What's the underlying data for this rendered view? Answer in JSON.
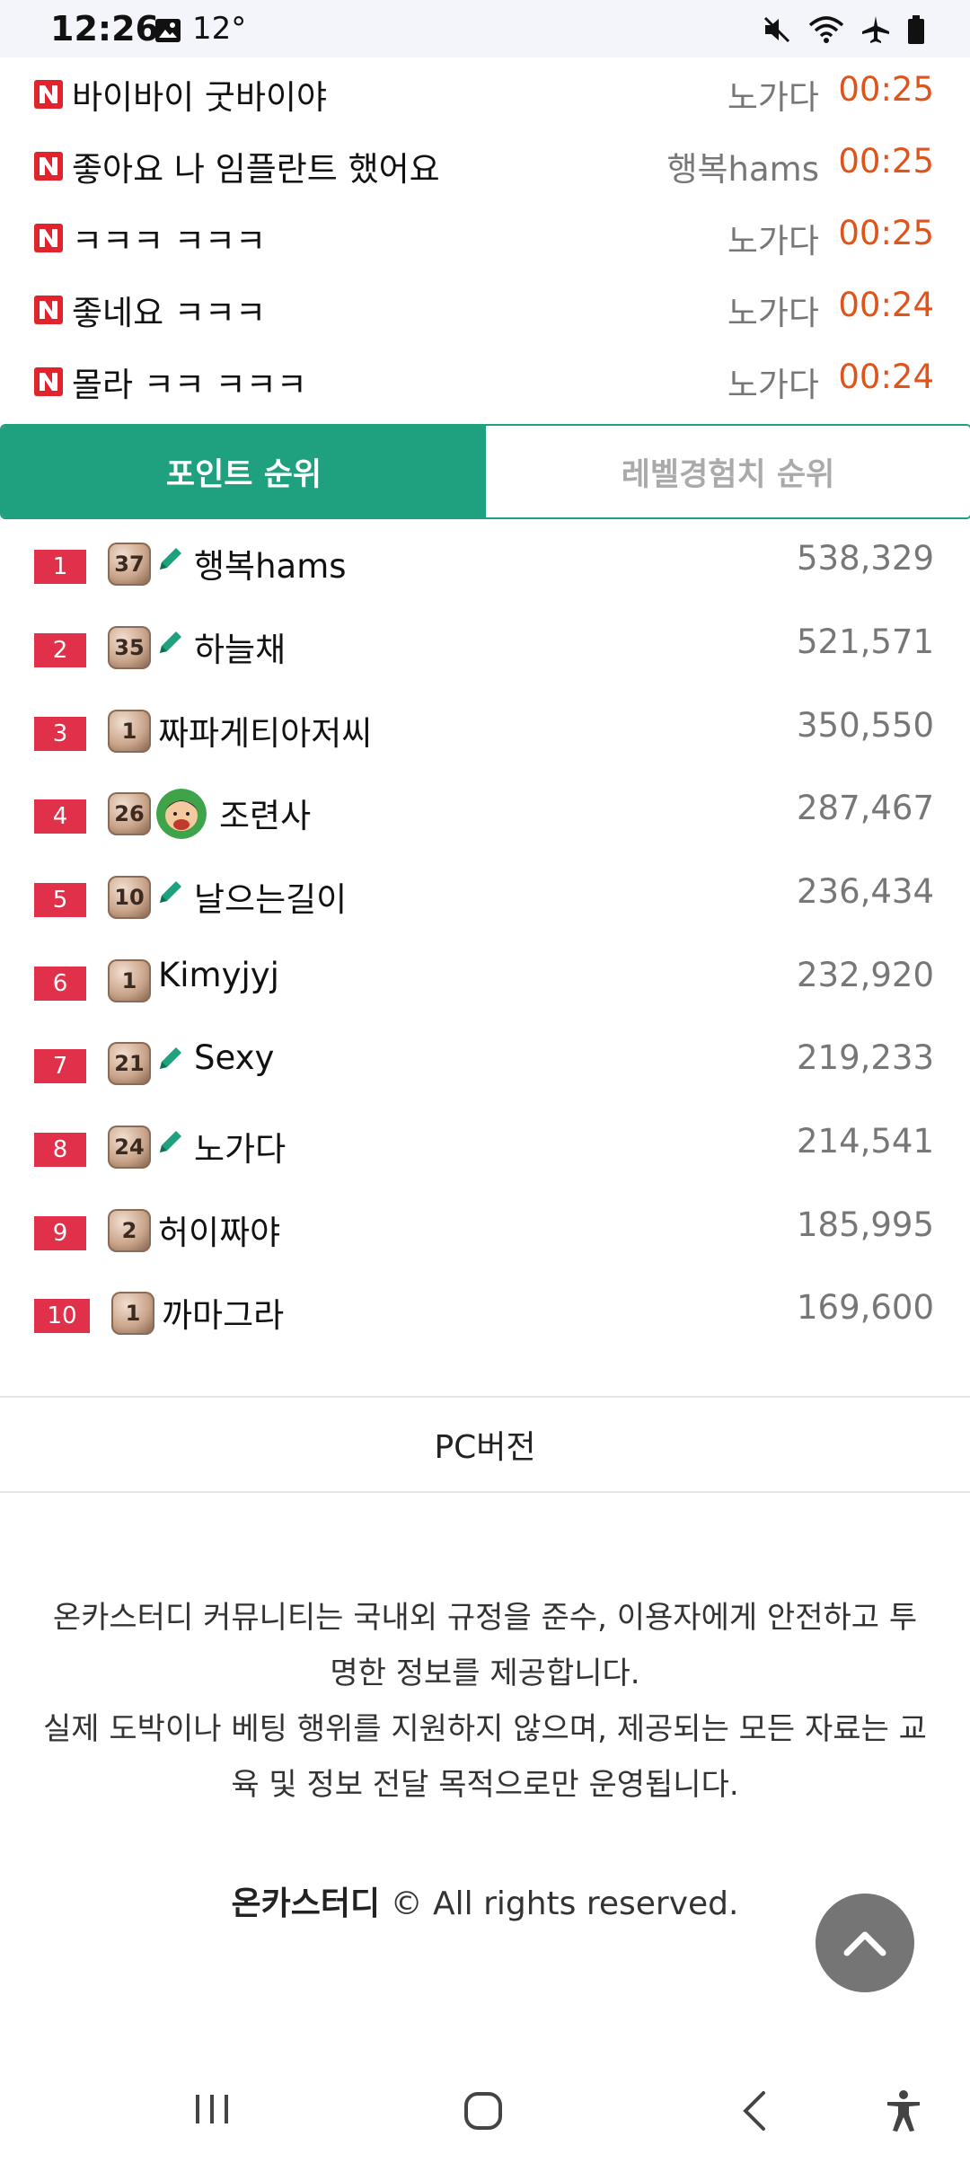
{
  "status_bar": {
    "time": "12:26",
    "temperature": "12°"
  },
  "comments": [
    {
      "text": "바이바이 굿바이야",
      "user": "노가다",
      "time": "00:25"
    },
    {
      "text": "좋아요 나 임플란트 했어요",
      "user": "행복hams",
      "time": "00:25"
    },
    {
      "text": "ㅋㅋㅋ ㅋㅋㅋ",
      "user": "노가다",
      "time": "00:25"
    },
    {
      "text": "좋네요 ㅋㅋㅋ",
      "user": "노가다",
      "time": "00:24"
    },
    {
      "text": "몰라 ㅋㅋ ㅋㅋㅋ",
      "user": "노가다",
      "time": "00:24"
    }
  ],
  "tabs": {
    "points": "포인트 순위",
    "level": "레벨경험치 순위"
  },
  "ranking": [
    {
      "rank": "1",
      "level": "37",
      "name": "행복hams",
      "score": "538,329",
      "icon": "pencil-icon"
    },
    {
      "rank": "2",
      "level": "35",
      "name": "하늘채",
      "score": "521,571",
      "icon": "pencil-icon"
    },
    {
      "rank": "3",
      "level": "1",
      "name": "짜파게티아저씨",
      "score": "350,550",
      "icon": ""
    },
    {
      "rank": "4",
      "level": "26",
      "name": "조련사",
      "score": "287,467",
      "icon": "avatar-icon"
    },
    {
      "rank": "5",
      "level": "10",
      "name": "날으는길이",
      "score": "236,434",
      "icon": "pencil-icon"
    },
    {
      "rank": "6",
      "level": "1",
      "name": "Kimyjyj",
      "score": "232,920",
      "icon": ""
    },
    {
      "rank": "7",
      "level": "21",
      "name": "Sexy",
      "score": "219,233",
      "icon": "pencil-icon"
    },
    {
      "rank": "8",
      "level": "24",
      "name": "노가다",
      "score": "214,541",
      "icon": "pencil-icon"
    },
    {
      "rank": "9",
      "level": "2",
      "name": "허이짜야",
      "score": "185,995",
      "icon": ""
    },
    {
      "rank": "10",
      "level": "1",
      "name": "까마그라",
      "score": "169,600",
      "icon": ""
    }
  ],
  "footer": {
    "pc_version": "PC버전",
    "notice_line1": "온카스터디 커뮤니티는 국내외 규정을 준수, 이용자에게 안전하고 투",
    "notice_line2": "명한 정보를 제공합니다.",
    "notice_line3": "실제 도박이나 베팅 행위를 지원하지 않으며, 제공되는 모든 자료는 교",
    "notice_line4": "육 및 정보 전달 목적으로만 운영됩니다.",
    "brand": "온카스터디",
    "copyright": "© All rights reserved."
  },
  "colors": {
    "accent": "#1fa07e",
    "rank_badge": "#e0304a",
    "time": "#e0541c",
    "news_badge": "#e0242c"
  }
}
